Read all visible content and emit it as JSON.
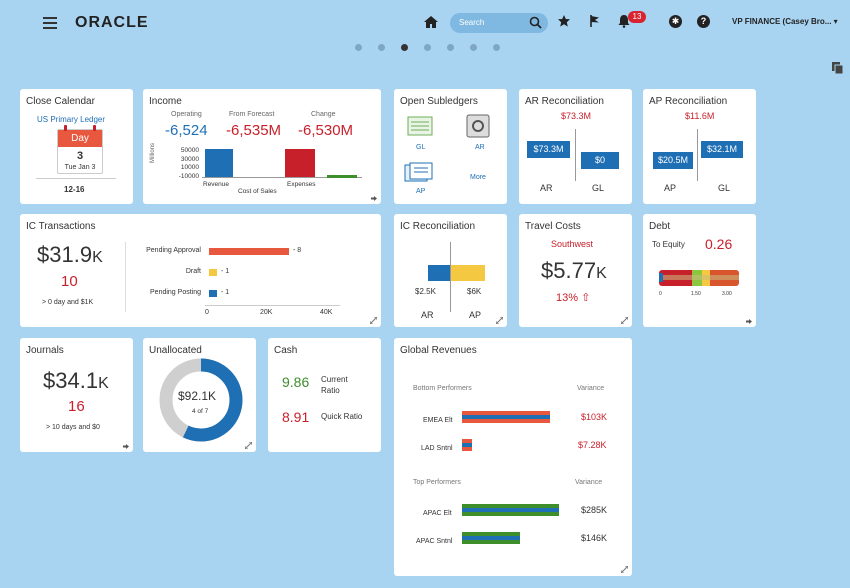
{
  "header": {
    "logo": "ORACLE",
    "search_placeholder": "Search",
    "notifications_count": "13",
    "user": "VP FINANCE (Casey Bro...",
    "accessibility": "✱",
    "help": "?"
  },
  "pager": {
    "pages": 7,
    "active": 3
  },
  "close_calendar": {
    "title": "Close Calendar",
    "ledger": "US Primary Ledger",
    "cal_label": "Day",
    "day": "3",
    "date": "Tue Jan 3",
    "period": "12-16"
  },
  "income": {
    "title": "Income",
    "operating_label": "Operating",
    "operating_value": "-6,524",
    "forecast_label": "From Forecast",
    "forecast_value": "-6,535M",
    "change_label": "Change",
    "change_value": "-6,530M",
    "y_unit": "Millions",
    "ticks": [
      "50000",
      "30000",
      "10000",
      "-10000"
    ],
    "cats": [
      "Revenue",
      "Cost of Sales",
      "Expenses"
    ],
    "colors": {
      "revenue": "#1f6fb5",
      "expenses": "#c8202b",
      "other": "#3e8e2c"
    }
  },
  "subledgers": {
    "title": "Open Subledgers",
    "items": [
      "GL",
      "AR",
      "AP",
      "More"
    ]
  },
  "ar_recon": {
    "title": "AR Reconciliation",
    "total": "$73.3M",
    "left_value": "$73.3M",
    "right_value": "$0",
    "left_label": "AR",
    "right_label": "GL"
  },
  "ap_recon": {
    "title": "AP Reconciliation",
    "total": "$11.6M",
    "left_value": "$20.5M",
    "right_value": "$32.1M",
    "left_label": "AP",
    "right_label": "GL"
  },
  "ic_transactions": {
    "title": "IC Transactions",
    "amount": "$31.9",
    "amount_unit": "K",
    "count": "10",
    "note": "> 0 day and $1K",
    "rows": [
      {
        "label": "Pending Approval",
        "value": 8,
        "text": "- 8",
        "color": "#e8583f"
      },
      {
        "label": "Draft",
        "value": 1,
        "text": "- 1",
        "color": "#f5c842"
      },
      {
        "label": "Pending Posting",
        "value": 1,
        "text": "- 1",
        "color": "#1f6fb5"
      }
    ],
    "axis": [
      "0",
      "20K",
      "40K"
    ]
  },
  "ic_recon": {
    "title": "IC Reconciliation",
    "left_value": "$2.5K",
    "right_value": "$6K",
    "left_label": "AR",
    "right_label": "AP"
  },
  "travel": {
    "title": "Travel Costs",
    "vendor": "Southwest",
    "amount": "$5.77",
    "amount_unit": "K",
    "change": "13%"
  },
  "debt": {
    "title": "Debt",
    "label": "To Equity",
    "value": "0.26",
    "axis": [
      "0",
      "1.50",
      "3.00"
    ]
  },
  "journals": {
    "title": "Journals",
    "amount": "$34.1",
    "amount_unit": "K",
    "count": "16",
    "note": "> 10 days and $0"
  },
  "unallocated": {
    "title": "Unallocated",
    "amount": "$92.1K",
    "sub": "4 of 7",
    "fraction": 0.571
  },
  "cash": {
    "title": "Cash",
    "current_value": "9.86",
    "current_label_1": "Current",
    "current_label_2": "Ratio",
    "quick_value": "8.91",
    "quick_label": "Quick Ratio"
  },
  "global_revenues": {
    "title": "Global Revenues",
    "bottom_header": "Bottom Performers",
    "top_header": "Top Performers",
    "variance_header": "Variance",
    "bottom": [
      {
        "name": "EMEA Elt",
        "variance": "$103K"
      },
      {
        "name": "LAD Sntnl",
        "variance": "$7.28K"
      }
    ],
    "top": [
      {
        "name": "APAC Elt",
        "variance": "$285K"
      },
      {
        "name": "APAC Sntnl",
        "variance": "$146K"
      }
    ]
  }
}
